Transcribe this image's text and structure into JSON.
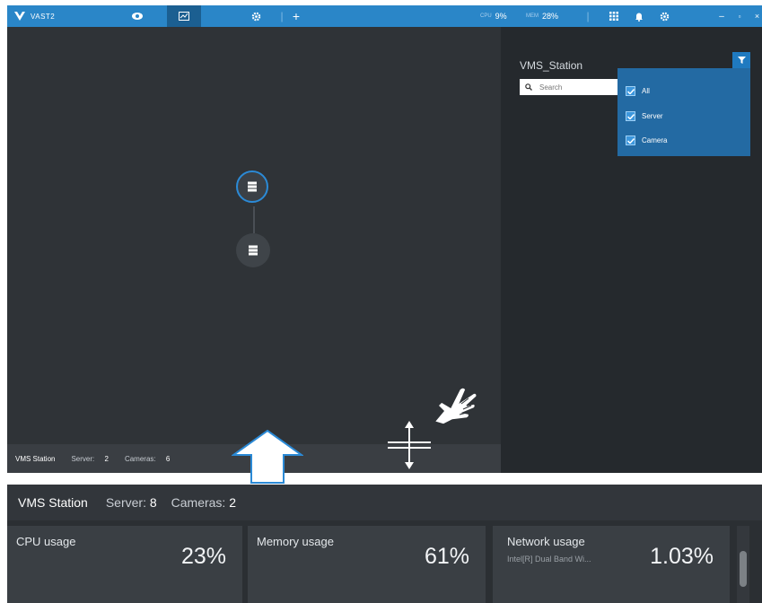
{
  "app": {
    "title": "VAST2"
  },
  "metrics": {
    "cpu_label": "CPU",
    "cpu_value": "9%",
    "mem_label": "MEM",
    "mem_value": "28%"
  },
  "window_controls": {
    "minimize": "–",
    "maximize": "▫",
    "close": "×"
  },
  "tabs": {
    "add_label": "+"
  },
  "panel": {
    "title": "VMS_Station",
    "search_placeholder": "Search",
    "filter_options": [
      {
        "label": "All",
        "checked": true
      },
      {
        "label": "Server",
        "checked": true
      },
      {
        "label": "Camera",
        "checked": true
      }
    ]
  },
  "status_top": {
    "title": "VMS Station",
    "server_label": "Server:",
    "server_count": "2",
    "cameras_label": "Cameras:",
    "cameras_count": "6"
  },
  "status_bottom": {
    "title": "VMS Station",
    "server_label": "Server:",
    "server_count": "8",
    "cameras_label": "Cameras:",
    "cameras_count": "2"
  },
  "cards": [
    {
      "title": "CPU usage",
      "value": "23%",
      "subtitle": ""
    },
    {
      "title": "Memory usage",
      "value": "61%",
      "subtitle": ""
    },
    {
      "title": "Network usage",
      "value": "1.03%",
      "subtitle": "Intel[R] Dual Band Wi..."
    }
  ],
  "colors": {
    "accent": "#2a86c8",
    "accent_dark": "#1b5f91",
    "dropdown": "#236aa3",
    "background": "#2f3337",
    "panel": "#25292d"
  }
}
